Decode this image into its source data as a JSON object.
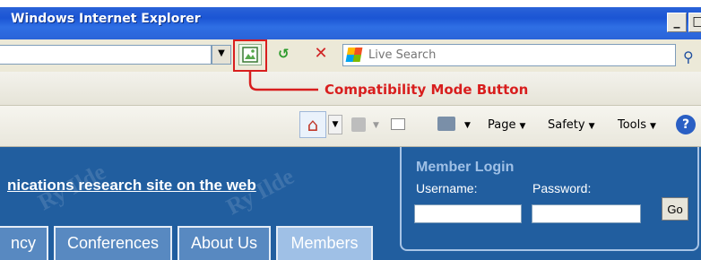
{
  "window": {
    "title": "Windows Internet Explorer",
    "minimize_label": "_",
    "maximize_label": "□"
  },
  "address_bar": {
    "dropdown_glyph": "▼"
  },
  "toolbar": {
    "refresh_glyph": "↺",
    "stop_glyph": "✕",
    "search_placeholder": "Live Search",
    "search_go_glyph": "⚲"
  },
  "annotation": {
    "label": "Compatibility Mode Button",
    "color": "#d81e1e"
  },
  "command_bar": {
    "page_label": "Page",
    "safety_label": "Safety",
    "tools_label": "Tools",
    "help_glyph": "?",
    "dropdown_glyph": "▼"
  },
  "site": {
    "tagline": "nications research site on the web",
    "watermark": "Ry Ilde",
    "nav_tabs": [
      {
        "label": "ncy",
        "active": false
      },
      {
        "label": "Conferences",
        "active": false
      },
      {
        "label": "About Us",
        "active": false
      },
      {
        "label": "Members",
        "active": true
      }
    ],
    "login": {
      "title": "Member Login",
      "username_label": "Username:",
      "password_label": "Password:",
      "go_label": "Go"
    }
  },
  "colors": {
    "titlebar": "#2a63d8",
    "site_header": "#215e9f",
    "tab": "#5889c1",
    "tab_active": "#9fc0e6"
  }
}
